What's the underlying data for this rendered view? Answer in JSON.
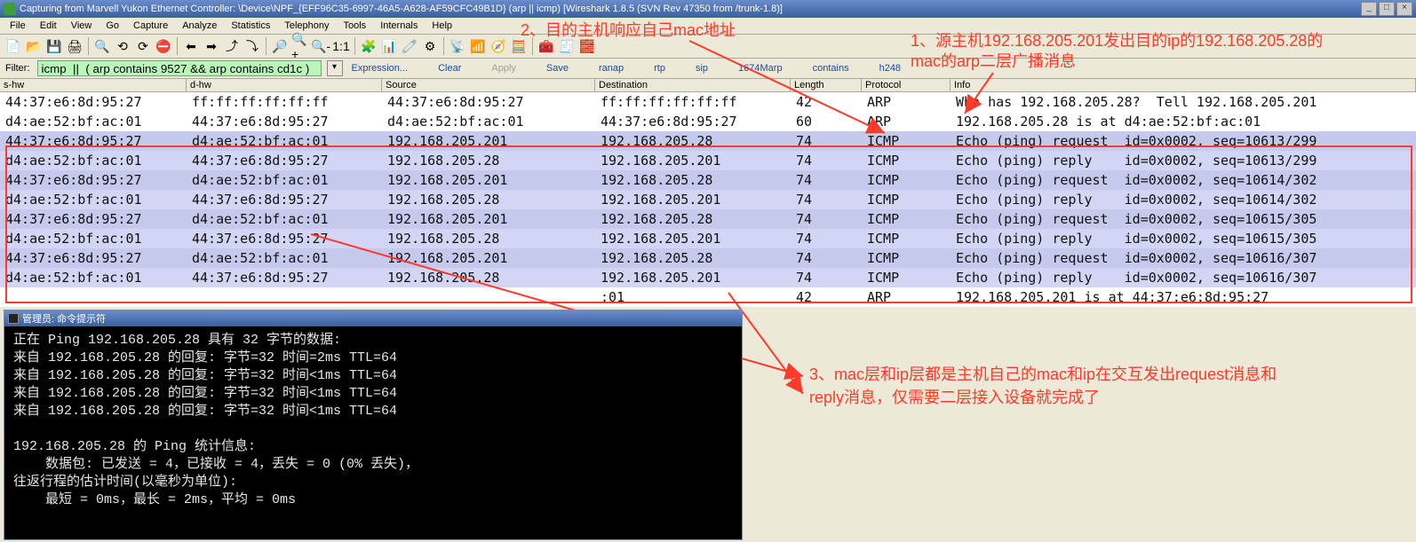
{
  "title": "Capturing from Marvell Yukon Ethernet Controller: \\Device\\NPF_{EFF96C35-6997-46A5-A628-AF59CFC49B1D} (arp  || icmp)   [Wireshark 1.8.5  (SVN Rev 47350 from /trunk-1.8)]",
  "window_buttons": {
    "min": "_",
    "max": "□",
    "close": "×"
  },
  "menu": [
    "File",
    "Edit",
    "View",
    "Go",
    "Capture",
    "Analyze",
    "Statistics",
    "Telephony",
    "Tools",
    "Internals",
    "Help"
  ],
  "toolbar_icons": [
    "📄",
    "📂",
    "💾",
    "🖨",
    "🔍",
    "⟲",
    "⟳",
    "⛔",
    "⬅",
    "➡",
    "⤴",
    "⤵",
    "🔎",
    "🔍+",
    "🔍-",
    "1:1",
    "🧩",
    "📊",
    "🧷",
    "⚙",
    "📡",
    "📶",
    "🧭",
    "🧮",
    "🧰",
    "🧾",
    "🧱"
  ],
  "filter": {
    "label": "Filter:",
    "value": "icmp  ||  ( arp contains 9527 && arp contains cd1c )",
    "dropdown": "▾",
    "buttons": [
      "Expression...",
      "Clear",
      "Apply",
      "Save",
      "ranap",
      "rtp",
      "sip",
      "1674Marp",
      "contains",
      "h248"
    ]
  },
  "columns": [
    "s-hw",
    "d-hw",
    "Source",
    "Destination",
    "Length",
    "Protocol",
    "Info"
  ],
  "rows": [
    {
      "cls": "clr-white",
      "shw": "44:37:e6:8d:95:27",
      "dhw": "ff:ff:ff:ff:ff:ff",
      "src": "44:37:e6:8d:95:27",
      "dst": "ff:ff:ff:ff:ff:ff",
      "len": "42",
      "pro": "ARP",
      "inf": "Who has 192.168.205.28?  Tell 192.168.205.201"
    },
    {
      "cls": "clr-white",
      "shw": "d4:ae:52:bf:ac:01",
      "dhw": "44:37:e6:8d:95:27",
      "src": "d4:ae:52:bf:ac:01",
      "dst": "44:37:e6:8d:95:27",
      "len": "60",
      "pro": "ARP",
      "inf": "192.168.205.28 is at d4:ae:52:bf:ac:01"
    },
    {
      "cls": "clr-sel",
      "shw": "44:37:e6:8d:95:27",
      "dhw": "d4:ae:52:bf:ac:01",
      "src": "192.168.205.201",
      "dst": "192.168.205.28",
      "len": "74",
      "pro": "ICMP",
      "inf": "Echo (ping) request  id=0x0002, seq=10613/299"
    },
    {
      "cls": "clr-lav",
      "shw": "d4:ae:52:bf:ac:01",
      "dhw": "44:37:e6:8d:95:27",
      "src": "192.168.205.28",
      "dst": "192.168.205.201",
      "len": "74",
      "pro": "ICMP",
      "inf": "Echo (ping) reply    id=0x0002, seq=10613/299"
    },
    {
      "cls": "clr-sel",
      "shw": "44:37:e6:8d:95:27",
      "dhw": "d4:ae:52:bf:ac:01",
      "src": "192.168.205.201",
      "dst": "192.168.205.28",
      "len": "74",
      "pro": "ICMP",
      "inf": "Echo (ping) request  id=0x0002, seq=10614/302"
    },
    {
      "cls": "clr-lav",
      "shw": "d4:ae:52:bf:ac:01",
      "dhw": "44:37:e6:8d:95:27",
      "src": "192.168.205.28",
      "dst": "192.168.205.201",
      "len": "74",
      "pro": "ICMP",
      "inf": "Echo (ping) reply    id=0x0002, seq=10614/302"
    },
    {
      "cls": "clr-sel",
      "shw": "44:37:e6:8d:95:27",
      "dhw": "d4:ae:52:bf:ac:01",
      "src": "192.168.205.201",
      "dst": "192.168.205.28",
      "len": "74",
      "pro": "ICMP",
      "inf": "Echo (ping) request  id=0x0002, seq=10615/305"
    },
    {
      "cls": "clr-lav",
      "shw": "d4:ae:52:bf:ac:01",
      "dhw": "44:37:e6:8d:95:27",
      "src": "192.168.205.28",
      "dst": "192.168.205.201",
      "len": "74",
      "pro": "ICMP",
      "inf": "Echo (ping) reply    id=0x0002, seq=10615/305"
    },
    {
      "cls": "clr-sel",
      "shw": "44:37:e6:8d:95:27",
      "dhw": "d4:ae:52:bf:ac:01",
      "src": "192.168.205.201",
      "dst": "192.168.205.28",
      "len": "74",
      "pro": "ICMP",
      "inf": "Echo (ping) request  id=0x0002, seq=10616/307"
    },
    {
      "cls": "clr-lav",
      "shw": "d4:ae:52:bf:ac:01",
      "dhw": "44:37:e6:8d:95:27",
      "src": "192.168.205.28",
      "dst": "192.168.205.201",
      "len": "74",
      "pro": "ICMP",
      "inf": "Echo (ping) reply    id=0x0002, seq=10616/307"
    },
    {
      "cls": "clr-white",
      "shw": "",
      "dhw": "",
      "src": "",
      "dst": ":01",
      "len": "42",
      "pro": "ARP",
      "inf": "192.168.205.201 is at 44:37:e6:8d:95:27"
    }
  ],
  "annotations": {
    "a2": "2、目的主机响应自己mac地址",
    "a1_l1": "1、源主机192.168.205.201发出目的ip的192.168.205.28的",
    "a1_l2": "mac的arp二层广播消息",
    "a3_l1": "3、mac层和ip层都是主机自己的mac和ip在交互发出request消息和",
    "a3_l2": "reply消息，仅需要二层接入设备就完成了"
  },
  "cmd": {
    "title": "管理员: 命令提示符",
    "lines": [
      "正在 Ping 192.168.205.28 具有 32 字节的数据:",
      "来自 192.168.205.28 的回复: 字节=32 时间=2ms TTL=64",
      "来自 192.168.205.28 的回复: 字节=32 时间<1ms TTL=64",
      "来自 192.168.205.28 的回复: 字节=32 时间<1ms TTL=64",
      "来自 192.168.205.28 的回复: 字节=32 时间<1ms TTL=64",
      "",
      "192.168.205.28 的 Ping 统计信息:",
      "    数据包: 已发送 = 4，已接收 = 4，丢失 = 0 (0% 丢失)，",
      "往返行程的估计时间(以毫秒为单位):",
      "    最短 = 0ms，最长 = 2ms，平均 = 0ms"
    ]
  }
}
